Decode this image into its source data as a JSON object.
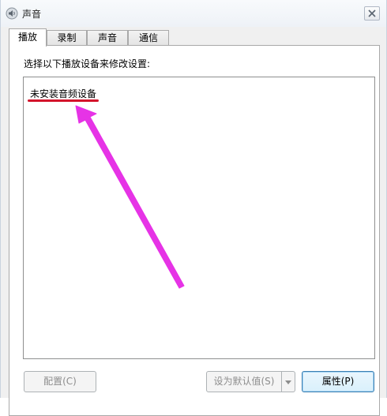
{
  "window": {
    "title": "声音",
    "app_icon": "speaker-icon"
  },
  "tabs": [
    {
      "label": "播放",
      "active": true
    },
    {
      "label": "录制",
      "active": false
    },
    {
      "label": "声音",
      "active": false
    },
    {
      "label": "通信",
      "active": false
    }
  ],
  "playback": {
    "instruction": "选择以下播放设备来修改设置:",
    "empty_message": "未安装音频设备"
  },
  "buttons": {
    "configure": "配置(C)",
    "set_default": "设为默认值(S)",
    "properties": "属性(P)"
  },
  "annotation": {
    "color": "#e633e6",
    "underline_color": "#d3142b"
  }
}
